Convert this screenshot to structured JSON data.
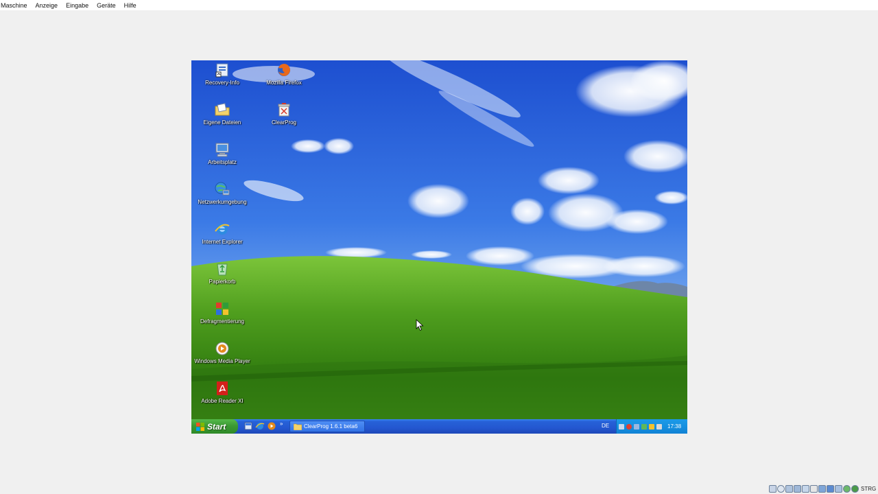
{
  "host": {
    "menu": [
      "Maschine",
      "Anzeige",
      "Eingabe",
      "Geräte",
      "Hilfe"
    ],
    "status_icons": [
      "hard-disk-icon",
      "optical-drive-icon",
      "audio-icon",
      "network-icon",
      "usb-icon",
      "shared-folder-icon",
      "display-icon",
      "video-capture-icon",
      "cpu-icon",
      "mouse-integration-icon",
      "keyboard-icon"
    ],
    "host_key_label": "STRG"
  },
  "desktop": {
    "icons": [
      {
        "label": "Recovery-Info",
        "icon": "recovery-info-icon"
      },
      {
        "label": "Mozilla Firefox",
        "icon": "firefox-icon"
      },
      {
        "label": "Eigene Dateien",
        "icon": "my-documents-icon"
      },
      {
        "label": "ClearProg",
        "icon": "clearprog-icon"
      },
      {
        "label": "Arbeitsplatz",
        "icon": "my-computer-icon"
      },
      {
        "label": "Netzwerkumgebung",
        "icon": "network-places-icon"
      },
      {
        "label": "Internet Explorer",
        "icon": "internet-explorer-icon"
      },
      {
        "label": "Papierkorb",
        "icon": "recycle-bin-icon"
      },
      {
        "label": "Defragmentierung",
        "icon": "defrag-icon"
      },
      {
        "label": "Windows Media Player",
        "icon": "media-player-icon"
      },
      {
        "label": "Adobe Reader XI",
        "icon": "adobe-reader-icon"
      }
    ]
  },
  "taskbar": {
    "start_label": "Start",
    "quick_launch": [
      "show-desktop-icon",
      "internet-explorer-icon",
      "media-player-icon"
    ],
    "task_button_label": "ClearProg 1.6.1 beta6",
    "language": "DE",
    "clock": "17:38"
  },
  "colors": {
    "taskbar_blue": "#2457d0",
    "start_green": "#3c9a34",
    "tray_blue": "#1590e0"
  }
}
